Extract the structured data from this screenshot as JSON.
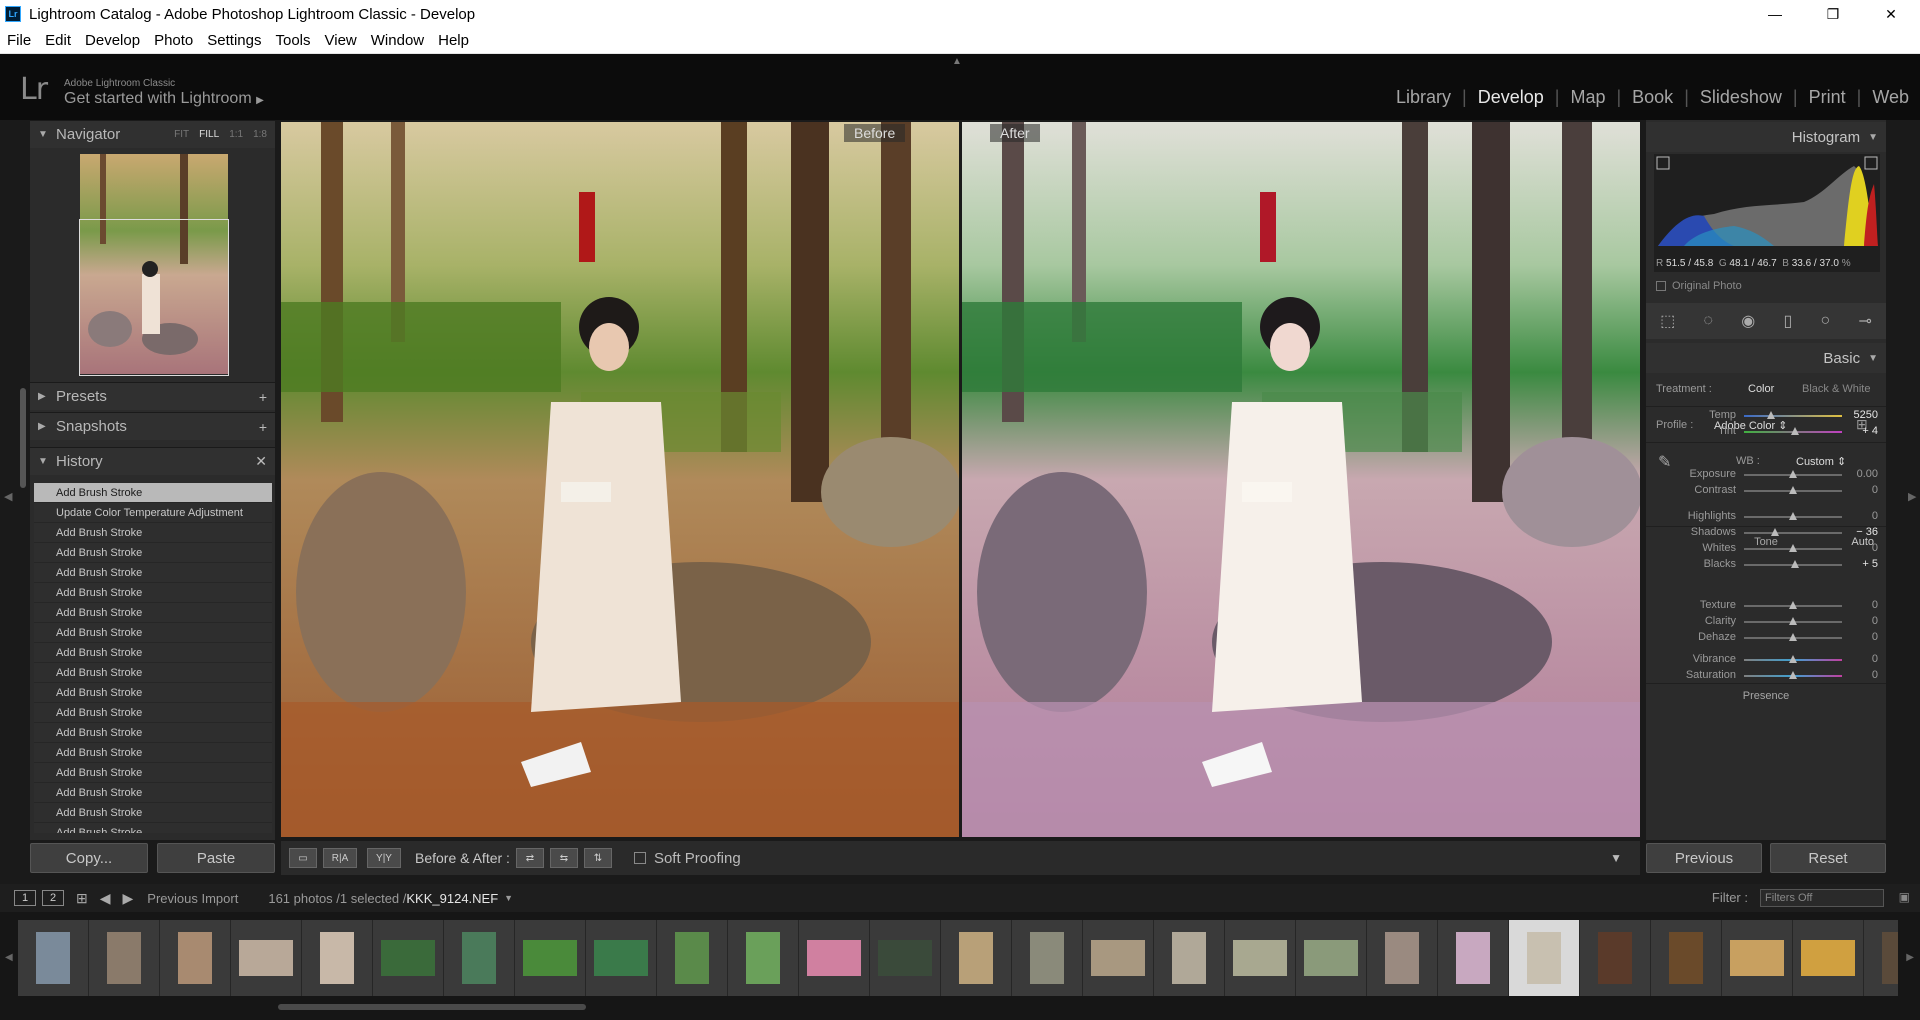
{
  "window": {
    "title": "Lightroom Catalog - Adobe Photoshop Lightroom Classic - Develop",
    "app_icon": "Lr",
    "controls": [
      "minimize",
      "restore",
      "close"
    ]
  },
  "menu": [
    "File",
    "Edit",
    "Develop",
    "Photo",
    "Settings",
    "Tools",
    "View",
    "Window",
    "Help"
  ],
  "identity": {
    "logo": "Lr",
    "small": "Adobe Lightroom Classic",
    "big": "Get started with Lightroom",
    "big_arrow": "▶"
  },
  "modules": [
    "Library",
    "Develop",
    "Map",
    "Book",
    "Slideshow",
    "Print",
    "Web"
  ],
  "active_module": "Develop",
  "left_panel": {
    "navigator": {
      "title": "Navigator",
      "options": [
        "FIT",
        "FILL",
        "1:1",
        "1:8"
      ],
      "active_option": "FILL"
    },
    "presets": {
      "title": "Presets"
    },
    "snapshots": {
      "title": "Snapshots"
    },
    "history": {
      "title": "History",
      "items": [
        "Add Brush Stroke",
        "Update Color Temperature Adjustment",
        "Add Brush Stroke",
        "Add Brush Stroke",
        "Add Brush Stroke",
        "Add Brush Stroke",
        "Add Brush Stroke",
        "Add Brush Stroke",
        "Add Brush Stroke",
        "Add Brush Stroke",
        "Add Brush Stroke",
        "Add Brush Stroke",
        "Add Brush Stroke",
        "Add Brush Stroke",
        "Add Brush Stroke",
        "Add Brush Stroke",
        "Add Brush Stroke",
        "Add Brush Stroke"
      ],
      "selected_index": 0
    },
    "copy_label": "Copy...",
    "paste_label": "Paste"
  },
  "compare": {
    "before_label": "Before",
    "after_label": "After"
  },
  "toolbar": {
    "btn_loupe": "▭",
    "btn_ra": "R|A",
    "btn_yy": "Y|Y",
    "before_after_label": "Before & After :",
    "soft_proofing": "Soft Proofing"
  },
  "right_panel": {
    "histogram_title": "Histogram",
    "rgb": {
      "r_label": "R",
      "r": "51.5 / 45.8",
      "g_label": "G",
      "g": "48.1 / 46.7",
      "b_label": "B",
      "b": "33.6 / 37.0",
      "unit": "%"
    },
    "original_photo": "Original Photo",
    "basic_title": "Basic",
    "treatment_label": "Treatment :",
    "treatment_color": "Color",
    "treatment_bw": "Black & White",
    "profile_label": "Profile :",
    "profile_value": "Adobe Color",
    "wb_label": "WB :",
    "wb_value": "Custom",
    "tone_label": "Tone",
    "auto_label": "Auto",
    "presence_label": "Presence",
    "sliders": [
      {
        "name": "Temp",
        "value": "5250",
        "pos": 0.28
      },
      {
        "name": "Tint",
        "value": "+ 4",
        "pos": 0.52
      },
      {
        "name": "Exposure",
        "value": "0.00",
        "pos": 0.5
      },
      {
        "name": "Contrast",
        "value": "0",
        "pos": 0.5
      },
      {
        "name": "Highlights",
        "value": "0",
        "pos": 0.5
      },
      {
        "name": "Shadows",
        "value": "− 36",
        "pos": 0.32
      },
      {
        "name": "Whites",
        "value": "0",
        "pos": 0.5
      },
      {
        "name": "Blacks",
        "value": "+ 5",
        "pos": 0.52
      },
      {
        "name": "Texture",
        "value": "0",
        "pos": 0.5
      },
      {
        "name": "Clarity",
        "value": "0",
        "pos": 0.5
      },
      {
        "name": "Dehaze",
        "value": "0",
        "pos": 0.5
      },
      {
        "name": "Vibrance",
        "value": "0",
        "pos": 0.5
      },
      {
        "name": "Saturation",
        "value": "0",
        "pos": 0.5
      }
    ],
    "previous_label": "Previous",
    "reset_label": "Reset"
  },
  "filmstrip": {
    "screen_1": "1",
    "screen_2": "2",
    "source": "Previous Import",
    "count": "161 photos /1 selected /",
    "filename": "KKK_9124.NEF",
    "filter_label": "Filter :",
    "filter_value": "Filters Off",
    "selected_cell": 21
  }
}
